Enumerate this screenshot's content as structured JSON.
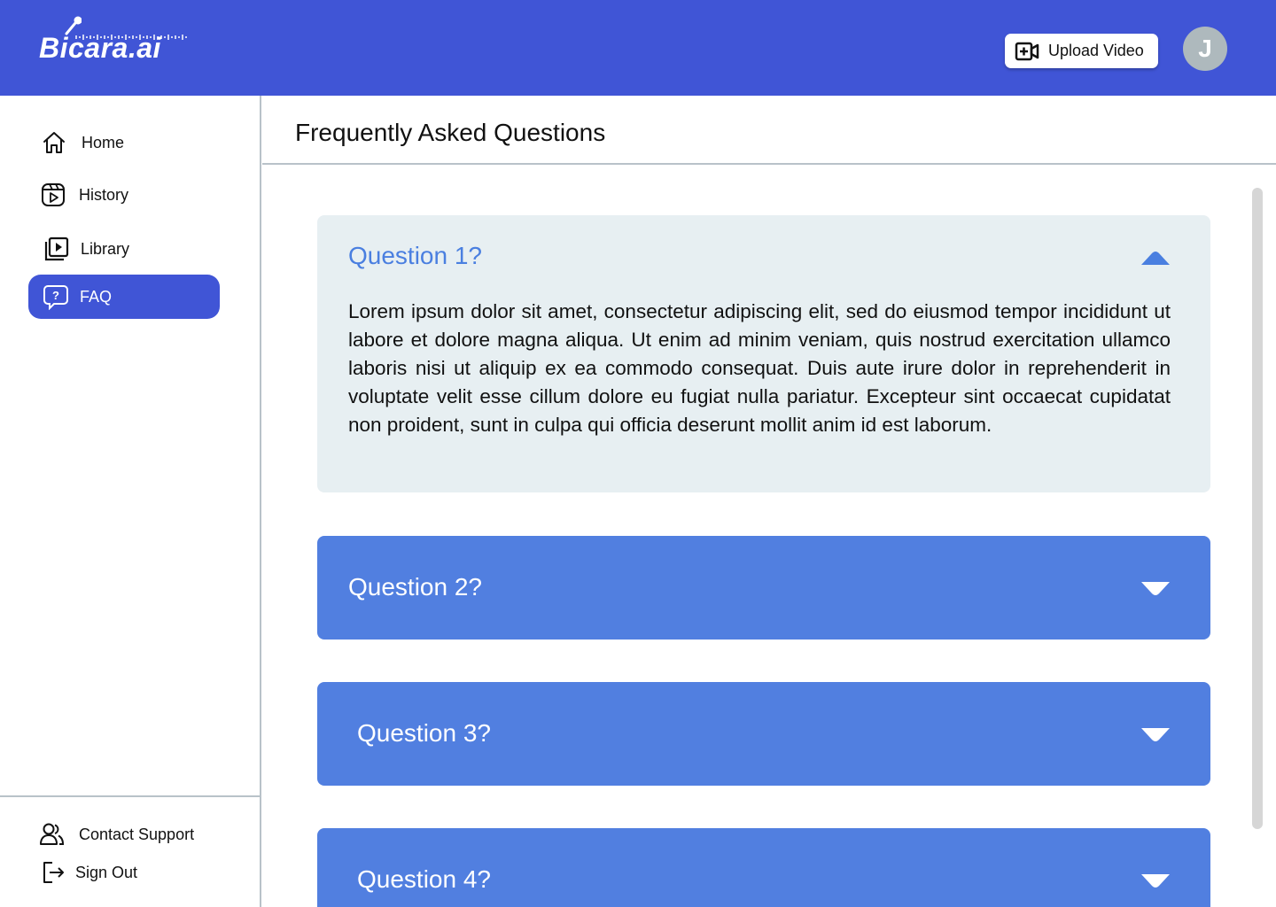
{
  "app": {
    "logo_text": "Bicara.ai"
  },
  "header": {
    "upload_label": "Upload Video",
    "avatar_initial": "J",
    "brand_color": "#4055d6"
  },
  "sidebar": {
    "items": [
      {
        "label": "Home",
        "icon": "home-icon",
        "active": false
      },
      {
        "label": "History",
        "icon": "history-icon",
        "active": false
      },
      {
        "label": "Library",
        "icon": "library-icon",
        "active": false
      },
      {
        "label": "FAQ",
        "icon": "faq-icon",
        "active": true
      }
    ],
    "footer": [
      {
        "label": "Contact Support",
        "icon": "users-icon"
      },
      {
        "label": "Sign Out",
        "icon": "sign-out-icon"
      }
    ]
  },
  "main": {
    "title": "Frequently Asked Questions",
    "faqs": [
      {
        "question": "Question 1?",
        "expanded": true,
        "answer": "Lorem ipsum dolor sit amet, consectetur adipiscing elit, sed do eiusmod tempor incididunt ut labore et dolore magna aliqua. Ut enim ad minim veniam, quis nostrud exercitation ullamco laboris nisi ut aliquip ex ea commodo consequat. Duis aute irure dolor in reprehenderit in voluptate velit esse cillum dolore eu fugiat nulla pariatur. Excepteur sint occaecat cupidatat non proident, sunt in culpa qui officia deserunt mollit anim id est laborum."
      },
      {
        "question": "Question 2?",
        "expanded": false
      },
      {
        "question": "Question 3?",
        "expanded": false
      },
      {
        "question": "Question 4?",
        "expanded": false
      }
    ],
    "colors": {
      "open_bg": "#e7eff2",
      "closed_bg": "#517fe0",
      "open_text": "#4a7fe0"
    }
  }
}
